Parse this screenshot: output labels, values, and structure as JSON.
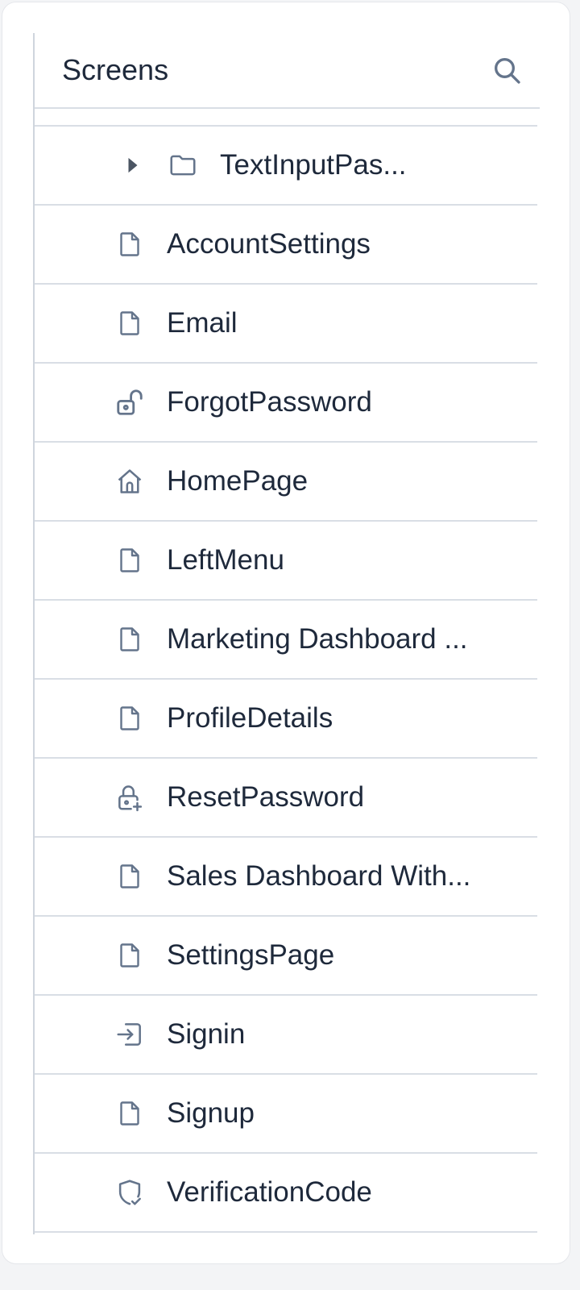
{
  "header": {
    "title": "Screens"
  },
  "icons": {
    "search": "search-icon"
  },
  "colors": {
    "text": "#1e293b",
    "icon": "#64748b",
    "divider": "#d9dee5"
  },
  "items": [
    {
      "label": "TextInputPas...",
      "icon": "folder-icon",
      "type": "folder"
    },
    {
      "label": "AccountSettings",
      "icon": "file-icon"
    },
    {
      "label": "Email",
      "icon": "file-icon"
    },
    {
      "label": "ForgotPassword",
      "icon": "unlock-icon"
    },
    {
      "label": "HomePage",
      "icon": "home-icon"
    },
    {
      "label": "LeftMenu",
      "icon": "file-icon"
    },
    {
      "label": "Marketing Dashboard ...",
      "icon": "file-icon"
    },
    {
      "label": "ProfileDetails",
      "icon": "file-icon"
    },
    {
      "label": "ResetPassword",
      "icon": "lock-plus-icon"
    },
    {
      "label": "Sales Dashboard With...",
      "icon": "file-icon"
    },
    {
      "label": "SettingsPage",
      "icon": "file-icon"
    },
    {
      "label": "Signin",
      "icon": "sign-in-icon"
    },
    {
      "label": "Signup",
      "icon": "file-icon"
    },
    {
      "label": "VerificationCode",
      "icon": "shield-check-icon"
    }
  ]
}
